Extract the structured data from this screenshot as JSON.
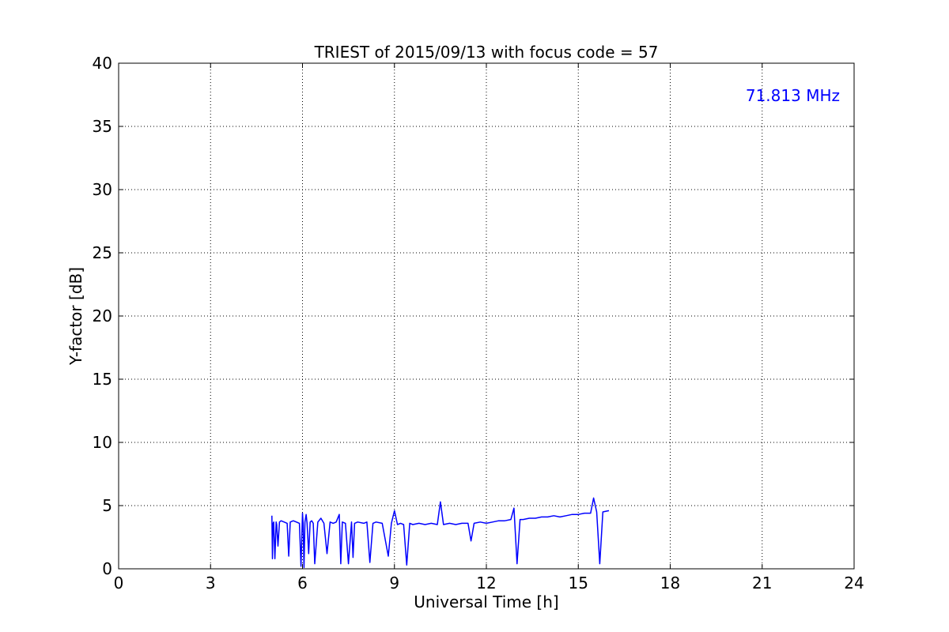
{
  "chart_data": {
    "type": "line",
    "title": "TRIEST of 2015/09/13 with focus code = 57",
    "xlabel": "Universal Time [h]",
    "ylabel": "Y-factor [dB]",
    "xlim": [
      0,
      24
    ],
    "ylim": [
      0,
      40
    ],
    "xticks": [
      0,
      3,
      6,
      9,
      12,
      15,
      18,
      21,
      24
    ],
    "yticks": [
      0,
      5,
      10,
      15,
      20,
      25,
      30,
      35,
      40
    ],
    "grid": true,
    "annotation": {
      "text": "71.813 MHz",
      "position": "top-right",
      "color": "#0000ff"
    },
    "series": [
      {
        "color": "#0000ff",
        "x": [
          5.0,
          5.02,
          5.04,
          5.06,
          5.1,
          5.14,
          5.16,
          5.2,
          5.25,
          5.3,
          5.4,
          5.5,
          5.55,
          5.6,
          5.7,
          5.8,
          5.9,
          5.95,
          6.0,
          6.02,
          6.05,
          6.08,
          6.12,
          6.15,
          6.2,
          6.25,
          6.3,
          6.35,
          6.4,
          6.5,
          6.6,
          6.7,
          6.8,
          6.9,
          7.0,
          7.1,
          7.2,
          7.25,
          7.3,
          7.4,
          7.5,
          7.6,
          7.65,
          7.7,
          7.8,
          8.0,
          8.1,
          8.2,
          8.3,
          8.4,
          8.6,
          8.8,
          8.9,
          9.0,
          9.1,
          9.2,
          9.3,
          9.4,
          9.5,
          9.6,
          9.8,
          10.0,
          10.2,
          10.4,
          10.5,
          10.6,
          10.8,
          11.0,
          11.2,
          11.4,
          11.5,
          11.6,
          11.8,
          12.0,
          12.2,
          12.4,
          12.5,
          12.6,
          12.8,
          12.9,
          13.0,
          13.1,
          13.2,
          13.4,
          13.6,
          13.8,
          14.0,
          14.2,
          14.4,
          14.6,
          14.8,
          15.0,
          15.2,
          15.4,
          15.5,
          15.6,
          15.7,
          15.8,
          16.0
        ],
        "y": [
          4.2,
          0.8,
          3.6,
          3.7,
          0.8,
          3.7,
          3.5,
          1.8,
          3.7,
          3.8,
          3.7,
          3.6,
          1.0,
          3.7,
          3.8,
          3.7,
          3.6,
          0.2,
          4.4,
          3.6,
          0.1,
          3.7,
          4.3,
          3.6,
          1.2,
          3.7,
          3.8,
          3.6,
          0.4,
          3.7,
          4.0,
          3.6,
          1.2,
          3.7,
          3.6,
          3.7,
          4.3,
          0.4,
          3.7,
          3.6,
          0.4,
          3.7,
          0.9,
          3.6,
          3.7,
          3.6,
          3.7,
          0.5,
          3.6,
          3.7,
          3.6,
          1.0,
          3.6,
          4.6,
          3.5,
          3.6,
          3.5,
          0.3,
          3.6,
          3.5,
          3.6,
          3.5,
          3.6,
          3.5,
          5.3,
          3.5,
          3.6,
          3.5,
          3.6,
          3.6,
          2.2,
          3.6,
          3.7,
          3.6,
          3.7,
          3.8,
          3.8,
          3.8,
          3.9,
          4.8,
          0.4,
          3.9,
          3.9,
          4.0,
          4.0,
          4.1,
          4.1,
          4.2,
          4.1,
          4.2,
          4.3,
          4.3,
          4.4,
          4.4,
          5.6,
          4.5,
          0.4,
          4.5,
          4.6
        ]
      }
    ]
  }
}
